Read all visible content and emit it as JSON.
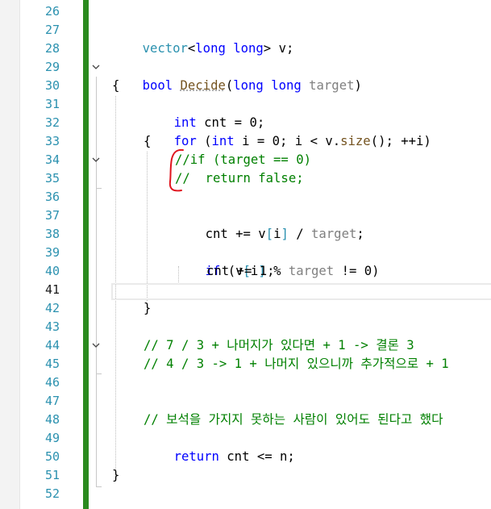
{
  "gutter": {
    "line_numbers": [
      "26",
      "27",
      "28",
      "29",
      "30",
      "31",
      "32",
      "33",
      "34",
      "35",
      "36",
      "37",
      "38",
      "39",
      "40",
      "41",
      "42",
      "43",
      "44",
      "45",
      "46",
      "47",
      "48",
      "49",
      "50",
      "51",
      "52"
    ],
    "current_line": "41"
  },
  "code": {
    "l27": {
      "t1": "vector",
      "t2": "<",
      "t3": "long long",
      "t4": "> v;"
    },
    "l29": {
      "kw": "bool",
      "fn": "Decide",
      "p1": "(",
      "t": "long long",
      "p2": " ",
      "param": "target",
      "p3": ")"
    },
    "l30": "{",
    "l31": {
      "kw": "int",
      "rest": " cnt = 0;"
    },
    "l32": {
      "kw1": "for",
      "a": " (",
      "kw2": "int",
      "b": " i = 0; i < v.",
      "fn": "size",
      "c": "(); ++i)"
    },
    "l33": "{",
    "l34": "//if (target == 0)",
    "l35": "//  return false;",
    "l37": {
      "a": "cnt += v",
      "b": "[",
      "c": "i",
      "d": "]",
      "e": " / ",
      "param": "target",
      "f": ";"
    },
    "l39": {
      "kw": "if",
      "a": " (v",
      "b": "[",
      "c": "i",
      "d": "]",
      "e": " % ",
      "param": "target",
      "f": " != 0)"
    },
    "l40": "cnt += 1;",
    "l42": "}",
    "l44": "// 7 / 3 + 나머지가 있다면 + 1 -> 결론 3",
    "l45": "// 4 / 3 -> 1 + 나머지 있으니까 추가적으로 + 1",
    "l48": "// 보석을 가지지 못하는 사람이 있어도 된다고 했다",
    "l49": {
      "kw": "return",
      "rest": " cnt <= n;"
    },
    "l51": "}"
  },
  "colors": {
    "keyword": "#0000ff",
    "type": "#2b91af",
    "comment": "#008000",
    "change_bar": "#2b8a1f",
    "annotation": "#e0141e"
  },
  "icons": [
    "fold-collapse-icon"
  ]
}
